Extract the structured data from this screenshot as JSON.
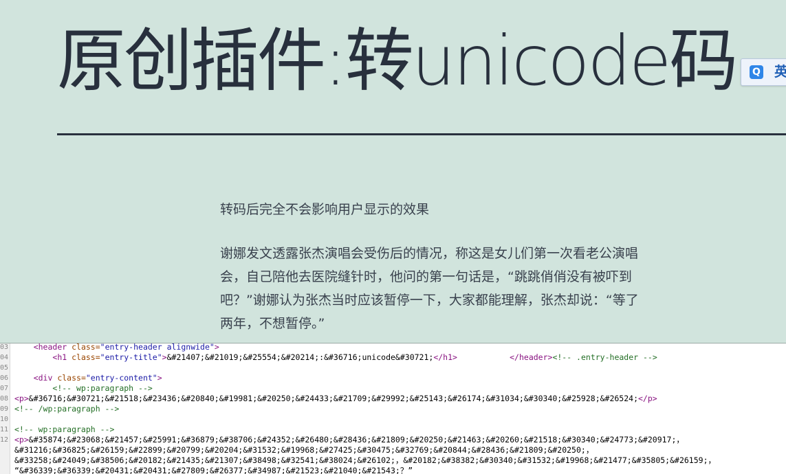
{
  "page": {
    "title": "原创插件:转unicode码",
    "ime": {
      "icon_letter": "Q",
      "language": "英"
    },
    "paragraphs": [
      "转码后完全不会影响用户显示的效果",
      "谢娜发文透露张杰演唱会受伤后的情况，称这是女儿们第一次看老公演唱会，自己陪他去医院缝针时，他问的第一句话是，“跳跳俏俏没有被吓到吧？”谢娜认为张杰当时应该暂停一下，大家都能理解，张杰却说：“等了两年，不想暂停。”"
    ]
  },
  "source": {
    "lines": [
      {
        "num": "03",
        "segments": [
          {
            "t": "    ",
            "c": "txt"
          },
          {
            "t": "<header",
            "c": "tag"
          },
          {
            "t": " class=",
            "c": "attr"
          },
          {
            "t": "\"entry-header alignwide\"",
            "c": "val"
          },
          {
            "t": ">",
            "c": "tag"
          }
        ]
      },
      {
        "num": "04",
        "segments": [
          {
            "t": "        ",
            "c": "txt"
          },
          {
            "t": "<h1",
            "c": "tag"
          },
          {
            "t": " class=",
            "c": "attr"
          },
          {
            "t": "\"entry-title\"",
            "c": "val"
          },
          {
            "t": ">",
            "c": "tag"
          },
          {
            "t": "&#21407;&#21019;&#25554;&#20214;:&#36716;unicode&#30721;",
            "c": "txt"
          },
          {
            "t": "</h1>",
            "c": "tag"
          },
          {
            "t": "           ",
            "c": "txt"
          },
          {
            "t": "</header>",
            "c": "tag"
          },
          {
            "t": "<!-- .entry-header -->",
            "c": "cmt"
          }
        ]
      },
      {
        "num": "05",
        "segments": []
      },
      {
        "num": "06",
        "segments": [
          {
            "t": "    ",
            "c": "txt"
          },
          {
            "t": "<div",
            "c": "tag"
          },
          {
            "t": " class=",
            "c": "attr"
          },
          {
            "t": "\"entry-content\"",
            "c": "val"
          },
          {
            "t": ">",
            "c": "tag"
          }
        ]
      },
      {
        "num": "07",
        "segments": [
          {
            "t": "        ",
            "c": "txt"
          },
          {
            "t": "<!-- wp:paragraph -->",
            "c": "cmt"
          }
        ]
      },
      {
        "num": "08",
        "segments": [
          {
            "t": "<p>",
            "c": "tag"
          },
          {
            "t": "&#36716;&#30721;&#21518;&#23436;&#20840;&#19981;&#20250;&#24433;&#21709;&#29992;&#25143;&#26174;&#31034;&#30340;&#25928;&#26524;",
            "c": "txt"
          },
          {
            "t": "</p>",
            "c": "tag"
          }
        ]
      },
      {
        "num": "09",
        "segments": [
          {
            "t": "<!-- /wp:paragraph -->",
            "c": "cmt"
          }
        ]
      },
      {
        "num": "10",
        "segments": []
      },
      {
        "num": "11",
        "segments": [
          {
            "t": "<!-- wp:paragraph -->",
            "c": "cmt"
          }
        ]
      },
      {
        "num": "12",
        "segments": [
          {
            "t": "<p>",
            "c": "tag"
          },
          {
            "t": "&#35874;&#23068;&#21457;&#25991;&#36879;&#38706;&#24352;&#26480;&#28436;&#21809;&#20250;&#21463;&#20260;&#21518;&#30340;&#24773;&#20917;，",
            "c": "txt"
          }
        ]
      },
      {
        "num": "",
        "segments": [
          {
            "t": "&#31216;&#36825;&#26159;&#22899;&#20799;&#20204;&#31532;&#19968;&#27425;&#30475;&#32769;&#20844;&#28436;&#21809;&#20250;，",
            "c": "txt"
          }
        ]
      },
      {
        "num": "",
        "segments": [
          {
            "t": "&#33258;&#24049;&#38506;&#20182;&#21435;&#21307;&#38498;&#32541;&#38024;&#26102;，&#20182;&#38382;&#30340;&#31532;&#19968;&#21477;&#35805;&#26159;，",
            "c": "txt"
          }
        ]
      },
      {
        "num": "",
        "segments": [
          {
            "t": "“&#36339;&#36339;&#20431;&#20431;&#27809;&#26377;&#34987;&#21523;&#21040;&#21543;？”",
            "c": "txt"
          }
        ]
      }
    ]
  }
}
